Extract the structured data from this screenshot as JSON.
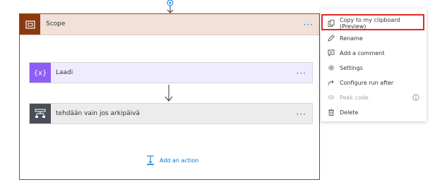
{
  "scope": {
    "title": "Scope"
  },
  "actions": [
    {
      "label": "Laadi"
    },
    {
      "label": "tehdään vain jos arkipäivä"
    }
  ],
  "add_action": {
    "label": "Add an action"
  },
  "more_glyph": "···",
  "menu": {
    "items": [
      {
        "label": "Copy to my clipboard (Preview)",
        "icon": "copy-icon"
      },
      {
        "label": "Rename",
        "icon": "pencil-icon"
      },
      {
        "label": "Add a comment",
        "icon": "comment-icon"
      },
      {
        "label": "Settings",
        "icon": "gear-icon"
      },
      {
        "label": "Configure run after",
        "icon": "run-after-icon"
      },
      {
        "label": "Peek code",
        "icon": "peek-code-icon",
        "disabled": true
      },
      {
        "label": "Delete",
        "icon": "trash-icon"
      }
    ]
  },
  "colors": {
    "scope_accent": "#8b3a0f",
    "compose_accent": "#8f5cf7",
    "condition_accent": "#484f58",
    "link": "#0078d4",
    "highlight": "#e32626"
  }
}
